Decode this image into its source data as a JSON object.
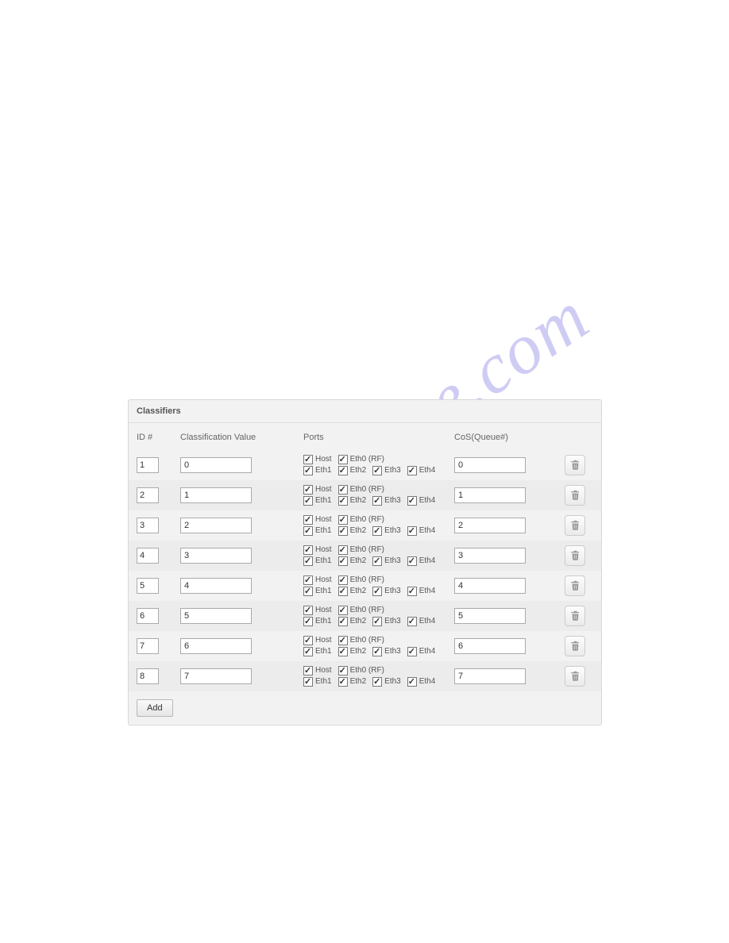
{
  "watermark": "manualshive.com",
  "panel": {
    "title": "Classifiers",
    "headers": {
      "id": "ID #",
      "classification": "Classification Value",
      "ports": "Ports",
      "cos": "CoS(Queue#)"
    },
    "port_labels": {
      "host": "Host",
      "eth0": "Eth0 (RF)",
      "eth1": "Eth1",
      "eth2": "Eth2",
      "eth3": "Eth3",
      "eth4": "Eth4"
    },
    "add_button": "Add",
    "rows": [
      {
        "id": "1",
        "classification": "0",
        "cos": "0",
        "ports": {
          "host": true,
          "eth0": true,
          "eth1": true,
          "eth2": true,
          "eth3": true,
          "eth4": true
        }
      },
      {
        "id": "2",
        "classification": "1",
        "cos": "1",
        "ports": {
          "host": true,
          "eth0": true,
          "eth1": true,
          "eth2": true,
          "eth3": true,
          "eth4": true
        }
      },
      {
        "id": "3",
        "classification": "2",
        "cos": "2",
        "ports": {
          "host": true,
          "eth0": true,
          "eth1": true,
          "eth2": true,
          "eth3": true,
          "eth4": true
        }
      },
      {
        "id": "4",
        "classification": "3",
        "cos": "3",
        "ports": {
          "host": true,
          "eth0": true,
          "eth1": true,
          "eth2": true,
          "eth3": true,
          "eth4": true
        }
      },
      {
        "id": "5",
        "classification": "4",
        "cos": "4",
        "ports": {
          "host": true,
          "eth0": true,
          "eth1": true,
          "eth2": true,
          "eth3": true,
          "eth4": true
        }
      },
      {
        "id": "6",
        "classification": "5",
        "cos": "5",
        "ports": {
          "host": true,
          "eth0": true,
          "eth1": true,
          "eth2": true,
          "eth3": true,
          "eth4": true
        }
      },
      {
        "id": "7",
        "classification": "6",
        "cos": "6",
        "ports": {
          "host": true,
          "eth0": true,
          "eth1": true,
          "eth2": true,
          "eth3": true,
          "eth4": true
        }
      },
      {
        "id": "8",
        "classification": "7",
        "cos": "7",
        "ports": {
          "host": true,
          "eth0": true,
          "eth1": true,
          "eth2": true,
          "eth3": true,
          "eth4": true
        }
      }
    ]
  }
}
